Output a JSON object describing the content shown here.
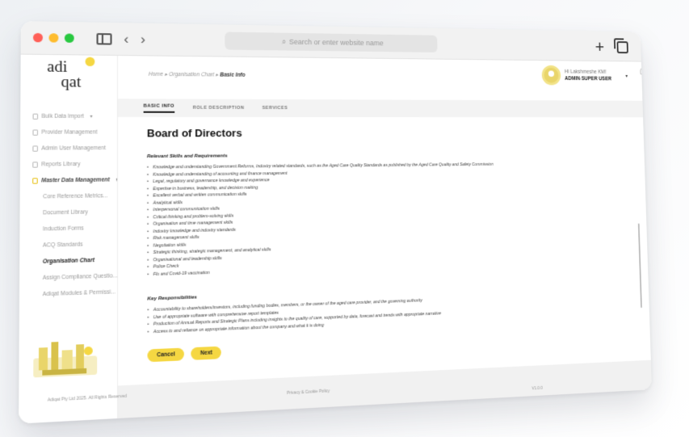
{
  "browser": {
    "address_placeholder": "Search or enter website name",
    "new_tab_label": "+"
  },
  "brand": {
    "logo_line1": "adi",
    "logo_line2": "qat"
  },
  "sidebar": {
    "items": [
      {
        "label": "Bulk Data Import",
        "chevron": "▾"
      },
      {
        "label": "Provider Management"
      },
      {
        "label": "Admin User Management"
      },
      {
        "label": "Reports Library"
      },
      {
        "label": "Master Data Management",
        "chevron": "▾"
      },
      {
        "label": "Core Reference Metrics..."
      },
      {
        "label": "Document Library"
      },
      {
        "label": "Induction Forms"
      },
      {
        "label": "ACQ Standards"
      },
      {
        "label": "Organisation Chart"
      },
      {
        "label": "Assign Compliance Questio..."
      },
      {
        "label": "Adiqat Modules & Permissi..."
      }
    ]
  },
  "breadcrumb": {
    "home": "Home",
    "parent": "Organisation Chart",
    "current": "Basic Info",
    "sep": "▸"
  },
  "user": {
    "greeting": "Hi Lakshmeshe KM!",
    "role": "ADMIN SUPER USER",
    "caret": "▾"
  },
  "tabs": [
    {
      "label": "BASIC INFO"
    },
    {
      "label": "ROLE DESCRIPTION"
    },
    {
      "label": "SERVICES"
    }
  ],
  "content": {
    "title": "Board of Directors",
    "skills_label": "Relevant Skills and Requirements",
    "skills": [
      "Knowledge and understanding Government Reforms, Industry related standards, such as the Aged Care Quality Standards as published by the Aged Care Quality and Safety Commission",
      "Knowledge and understanding of accounting and finance management",
      "Legal, regulatory and governance knowledge and experience",
      "Expertise in business, leadership, and decision making",
      "Excellent verbal and written communication skills",
      "Analytical skills",
      "Interpersonal communication skills",
      "Critical thinking and problem-solving skills",
      "Organisation and time management skills",
      "Industry knowledge and industry standards",
      "Risk management skills",
      "Negotiation skills",
      "Strategic thinking, strategic management, and analytical skills",
      "Organisational and leadership skills",
      "Police Check",
      "Flu and Covid-19 vaccination"
    ],
    "responsibilities_label": "Key Responsibilities",
    "responsibilities": [
      "Accountability to shareholders/investors, including funding bodies, members, or the owner of the aged care provider, and the governing authority",
      "Use of appropriate software with comprehensive report templates",
      "Production of Annual Reports and Strategic Plans including insights to the quality of care, supported by data, forecast and trends with appropriate narrative",
      "Access to and reliance on appropriate information about the company and what it is doing"
    ]
  },
  "actions": {
    "cancel": "Cancel",
    "next": "Next"
  },
  "footer": {
    "copyright": "Adiqat Pty Ltd 2025. All Rights Reserved",
    "privacy": "Privacy & Cookie Policy",
    "version": "V1.0.0"
  },
  "colors": {
    "accent": "#f5d742",
    "sidebar_active_icon": "#e8c21a"
  }
}
